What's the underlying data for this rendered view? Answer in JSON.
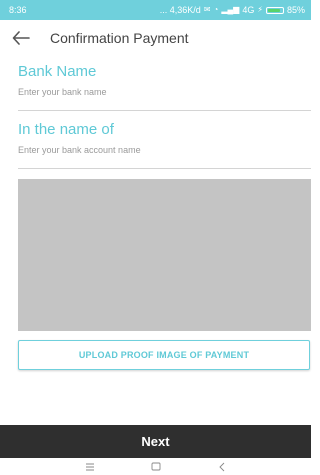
{
  "status_bar": {
    "time": "8:36",
    "network_info": "... 4,36K/d",
    "signal_text": "4G",
    "battery": "85%",
    "battery_level": 0.85,
    "background_color": "#6fd0dc"
  },
  "app_bar": {
    "title": "Confirmation Payment",
    "back_icon": "arrow-left-icon"
  },
  "form": {
    "bank_name": {
      "label": "Bank Name",
      "placeholder": "Enter your bank name",
      "value": ""
    },
    "account_name": {
      "label": "In the name of",
      "placeholder": "Enter your bank account name",
      "value": ""
    }
  },
  "upload": {
    "button_label": "UPLOAD PROOF IMAGE OF PAYMENT"
  },
  "footer": {
    "next_label": "Next"
  },
  "colors": {
    "accent": "#5fc9d6",
    "next_button_bg": "#2f2f2f",
    "image_placeholder": "#c4c4c4"
  },
  "nav_icons": [
    "menu-icon",
    "home-square-icon",
    "back-chevron-icon"
  ]
}
